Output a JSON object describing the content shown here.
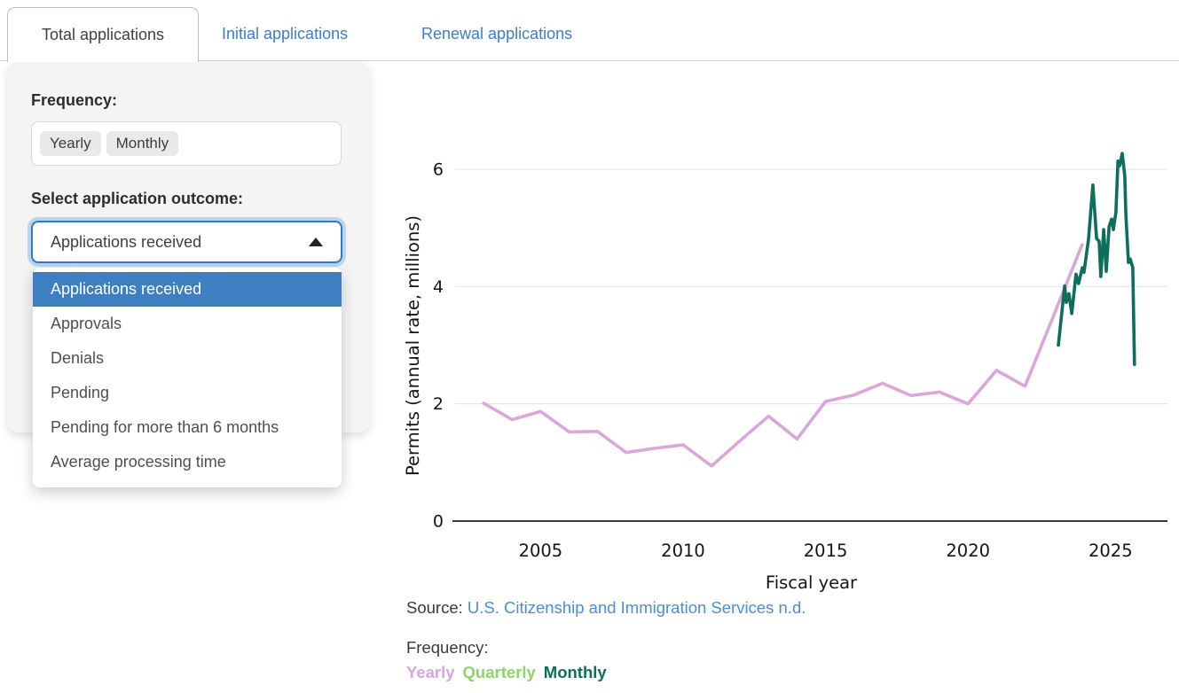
{
  "tabs": {
    "items": [
      {
        "label": "Total applications",
        "active": true
      },
      {
        "label": "Initial applications",
        "active": false
      },
      {
        "label": "Renewal applications",
        "active": false
      }
    ]
  },
  "filter_panel": {
    "frequency_label": "Frequency:",
    "frequency_options": [
      "Yearly",
      "Monthly"
    ],
    "outcome_label": "Select application outcome:",
    "select": {
      "value": "Applications received",
      "state": "expanded"
    },
    "dropdown_options": [
      {
        "label": "Applications received",
        "selected": true
      },
      {
        "label": "Approvals",
        "selected": false
      },
      {
        "label": "Denials",
        "selected": false
      },
      {
        "label": "Pending",
        "selected": false
      },
      {
        "label": "Pending for more than 6 months",
        "selected": false
      },
      {
        "label": "Average processing time",
        "selected": false
      }
    ]
  },
  "chart_data": {
    "type": "line",
    "title": "",
    "xlabel": "Fiscal year",
    "ylabel": "Permits (annual rate, millions)",
    "xticks": [
      2005,
      2010,
      2015,
      2020,
      2025
    ],
    "yticks": [
      0,
      2,
      4,
      6
    ],
    "xlim": [
      2002,
      2027
    ],
    "ylim": [
      0,
      6.6
    ],
    "grid": true,
    "legend_position": "below",
    "series": [
      {
        "name": "Yearly",
        "color": "#d9a7d9",
        "x": [
          2003,
          2004,
          2005,
          2006,
          2007,
          2008,
          2009,
          2010,
          2011,
          2012,
          2013,
          2014,
          2015,
          2016,
          2017,
          2018,
          2019,
          2020,
          2021,
          2022,
          2023,
          2024
        ],
        "y": [
          2.01,
          1.73,
          1.87,
          1.52,
          1.53,
          1.17,
          1.24,
          1.3,
          0.94,
          1.37,
          1.79,
          1.4,
          2.04,
          2.15,
          2.35,
          2.14,
          2.2,
          2.0,
          2.57,
          2.3,
          3.5,
          4.71
        ]
      },
      {
        "name": "Monthly",
        "color": "#0d6e5b",
        "x": [
          2023.17,
          2023.39,
          2023.45,
          2023.54,
          2023.64,
          2023.79,
          2023.88,
          2024.01,
          2024.07,
          2024.23,
          2024.38,
          2024.51,
          2024.6,
          2024.66,
          2024.76,
          2024.85,
          2024.95,
          2025.04,
          2025.1,
          2025.19,
          2025.26,
          2025.32,
          2025.41,
          2025.5,
          2025.54,
          2025.63,
          2025.69,
          2025.78,
          2025.84
        ],
        "y": [
          3.0,
          4.01,
          3.73,
          3.88,
          3.54,
          4.21,
          4.05,
          4.32,
          4.24,
          4.82,
          5.73,
          4.82,
          4.77,
          4.17,
          4.97,
          4.26,
          5.02,
          5.15,
          4.97,
          5.27,
          6.14,
          6.06,
          6.27,
          5.88,
          5.23,
          4.41,
          4.47,
          4.32,
          2.67
        ]
      }
    ]
  },
  "source": {
    "prefix": "Source:",
    "link_text": "U.S. Citizenship and Immigration Services n.d."
  },
  "legend": {
    "title": "Frequency:",
    "items": [
      {
        "label": "Yearly",
        "color": "#d5a8da"
      },
      {
        "label": "Quarterly",
        "color": "#8fd466"
      },
      {
        "label": "Monthly",
        "color": "#0d6e5b"
      }
    ]
  },
  "colors": {
    "dropdown_highlight": "#3d7fc0",
    "tab_link_blue": "#3b7ecb",
    "source_link_blue": "#4a8ed6",
    "yearly_line": "#d9a7d9",
    "monthly_line": "#0d6e5b",
    "panel_background": "#f4f4f4",
    "select_focus_border": "#2e7dc2"
  }
}
